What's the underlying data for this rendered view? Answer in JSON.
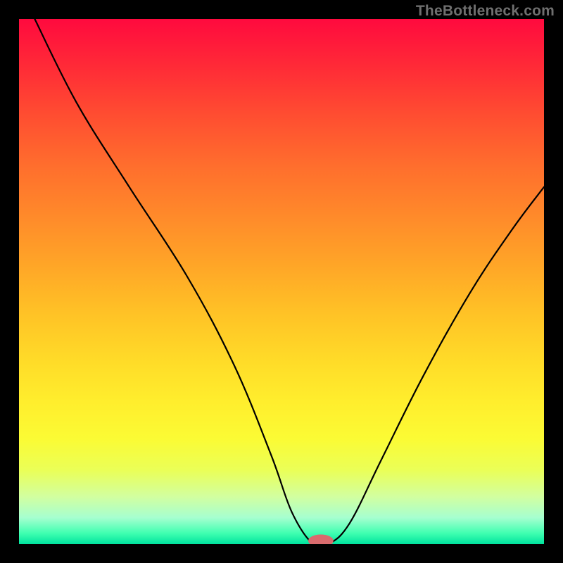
{
  "watermark": "TheBottleneck.com",
  "colors": {
    "page_bg": "#000000",
    "curve_stroke": "#000000",
    "marker_fill": "#d96b6d",
    "gradient_top": "#ff0a3e",
    "gradient_bottom": "#00e39e"
  },
  "chart_data": {
    "type": "line",
    "title": "",
    "xlabel": "",
    "ylabel": "",
    "xlim": [
      0,
      1
    ],
    "ylim": [
      0,
      1
    ],
    "grid": false,
    "series": [
      {
        "name": "bottleneck-curve",
        "x": [
          0.03,
          0.11,
          0.21,
          0.32,
          0.41,
          0.48,
          0.52,
          0.56,
          0.59,
          0.63,
          0.69,
          0.77,
          0.86,
          0.94,
          1.0
        ],
        "y": [
          1.0,
          0.84,
          0.68,
          0.51,
          0.34,
          0.17,
          0.06,
          0.0,
          0.0,
          0.04,
          0.16,
          0.32,
          0.48,
          0.6,
          0.68
        ]
      }
    ],
    "marker": {
      "x": 0.575,
      "y": 0.0,
      "rx": 0.024,
      "ry": 0.012
    }
  }
}
